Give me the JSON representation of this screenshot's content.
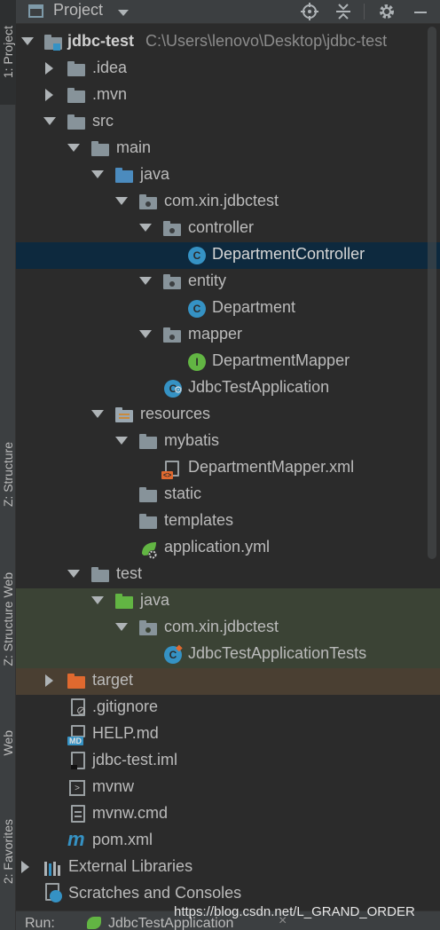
{
  "side_tabs": [
    {
      "label": "1: Project",
      "icon": "project-icon"
    },
    {
      "label": "Z: Structure",
      "icon": "structure-icon"
    },
    {
      "label": "Z: Structure Web",
      "icon": "structure-web-icon"
    },
    {
      "label": "Web",
      "icon": "web-icon"
    },
    {
      "label": "2: Favorites",
      "icon": "favorites-icon"
    }
  ],
  "header": {
    "title": "Project",
    "buttons": [
      "locate-icon",
      "collapse-all-icon",
      "gear-icon",
      "minimize-icon"
    ]
  },
  "tree": [
    {
      "label": "jdbc-test",
      "path": "C:\\Users\\lenovo\\Desktop\\jdbc-test",
      "icon": "module-folder-icon",
      "expanded": true,
      "bold": true
    },
    {
      "label": ".idea",
      "icon": "folder-icon",
      "expanded": false
    },
    {
      "label": ".mvn",
      "icon": "folder-icon",
      "expanded": false
    },
    {
      "label": "src",
      "icon": "folder-icon",
      "expanded": true
    },
    {
      "label": "main",
      "icon": "folder-icon",
      "expanded": true
    },
    {
      "label": "java",
      "icon": "source-root-icon",
      "expanded": true
    },
    {
      "label": "com.xin.jdbctest",
      "icon": "package-icon",
      "expanded": true
    },
    {
      "label": "controller",
      "icon": "package-icon",
      "expanded": true
    },
    {
      "label": "DepartmentController",
      "icon": "class-icon",
      "selected": true
    },
    {
      "label": "entity",
      "icon": "package-icon",
      "expanded": true
    },
    {
      "label": "Department",
      "icon": "class-icon"
    },
    {
      "label": "mapper",
      "icon": "package-icon",
      "expanded": true
    },
    {
      "label": "DepartmentMapper",
      "icon": "interface-icon"
    },
    {
      "label": "JdbcTestApplication",
      "icon": "spring-boot-class-icon"
    },
    {
      "label": "resources",
      "icon": "resources-root-icon",
      "expanded": true
    },
    {
      "label": "mybatis",
      "icon": "folder-icon",
      "expanded": true
    },
    {
      "label": "DepartmentMapper.xml",
      "icon": "xml-file-icon"
    },
    {
      "label": "static",
      "icon": "folder-icon"
    },
    {
      "label": "templates",
      "icon": "folder-icon"
    },
    {
      "label": "application.yml",
      "icon": "spring-config-icon"
    },
    {
      "label": "test",
      "icon": "folder-icon",
      "expanded": true
    },
    {
      "label": "java",
      "icon": "test-root-icon",
      "expanded": true
    },
    {
      "label": "com.xin.jdbctest",
      "icon": "package-icon",
      "expanded": true
    },
    {
      "label": "JdbcTestApplicationTests",
      "icon": "test-class-icon"
    },
    {
      "label": "target",
      "icon": "excluded-folder-icon",
      "expanded": false
    },
    {
      "label": ".gitignore",
      "icon": "gitignore-file-icon"
    },
    {
      "label": "HELP.md",
      "icon": "markdown-file-icon"
    },
    {
      "label": "jdbc-test.iml",
      "icon": "iml-file-icon"
    },
    {
      "label": "mvnw",
      "icon": "shell-file-icon"
    },
    {
      "label": "mvnw.cmd",
      "icon": "text-file-icon"
    },
    {
      "label": "pom.xml",
      "icon": "maven-file-icon"
    },
    {
      "label": "External Libraries",
      "icon": "libraries-icon",
      "expanded": false
    },
    {
      "label": "Scratches and Consoles",
      "icon": "scratches-icon"
    }
  ],
  "run_bar": {
    "label": "Run:",
    "config": "JdbcTestApplication"
  },
  "watermark": "https://blog.csdn.net/L_GRAND_ORDER",
  "colors": {
    "folder": "#87939a",
    "source_root": "#4b8bbe",
    "resources_root": "#9aa7b0",
    "test_root": "#62b543",
    "excluded": "#e0692f",
    "class": "#3592c4",
    "interface": "#62b543",
    "selection": "#0d293e"
  }
}
